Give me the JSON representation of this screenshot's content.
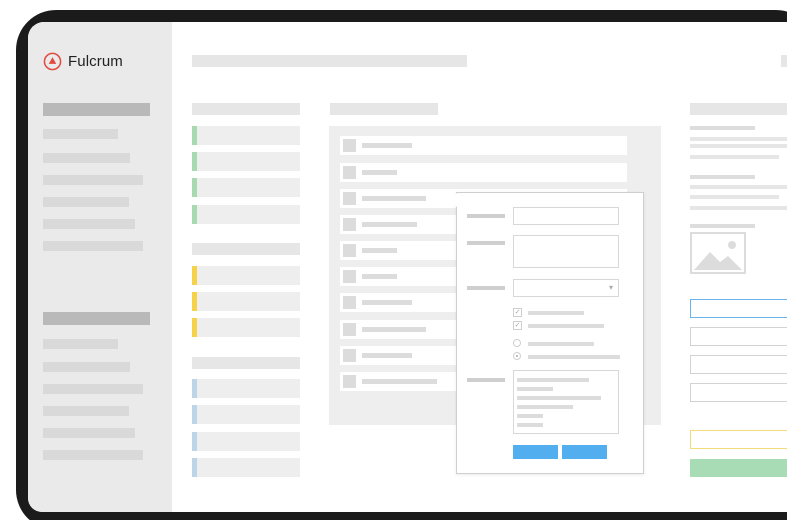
{
  "app": {
    "brand": "Fulcrum",
    "logo_icon": "fulcrum-logo-icon",
    "accent_color": "#e24a3f"
  },
  "colors": {
    "green": "#a9d9b0",
    "yellow": "#f5d24a",
    "blue": "#bdd5e8",
    "button": "#52aeee",
    "focus": "#6ab4ee"
  },
  "popover": {
    "checkbox_icons": [
      "checkbox-checked-icon",
      "checkbox-checked-icon"
    ],
    "select_icon": "chevron-down-icon",
    "chevron": "▾",
    "check": "✓"
  },
  "image_placeholder_icon": "image-icon"
}
